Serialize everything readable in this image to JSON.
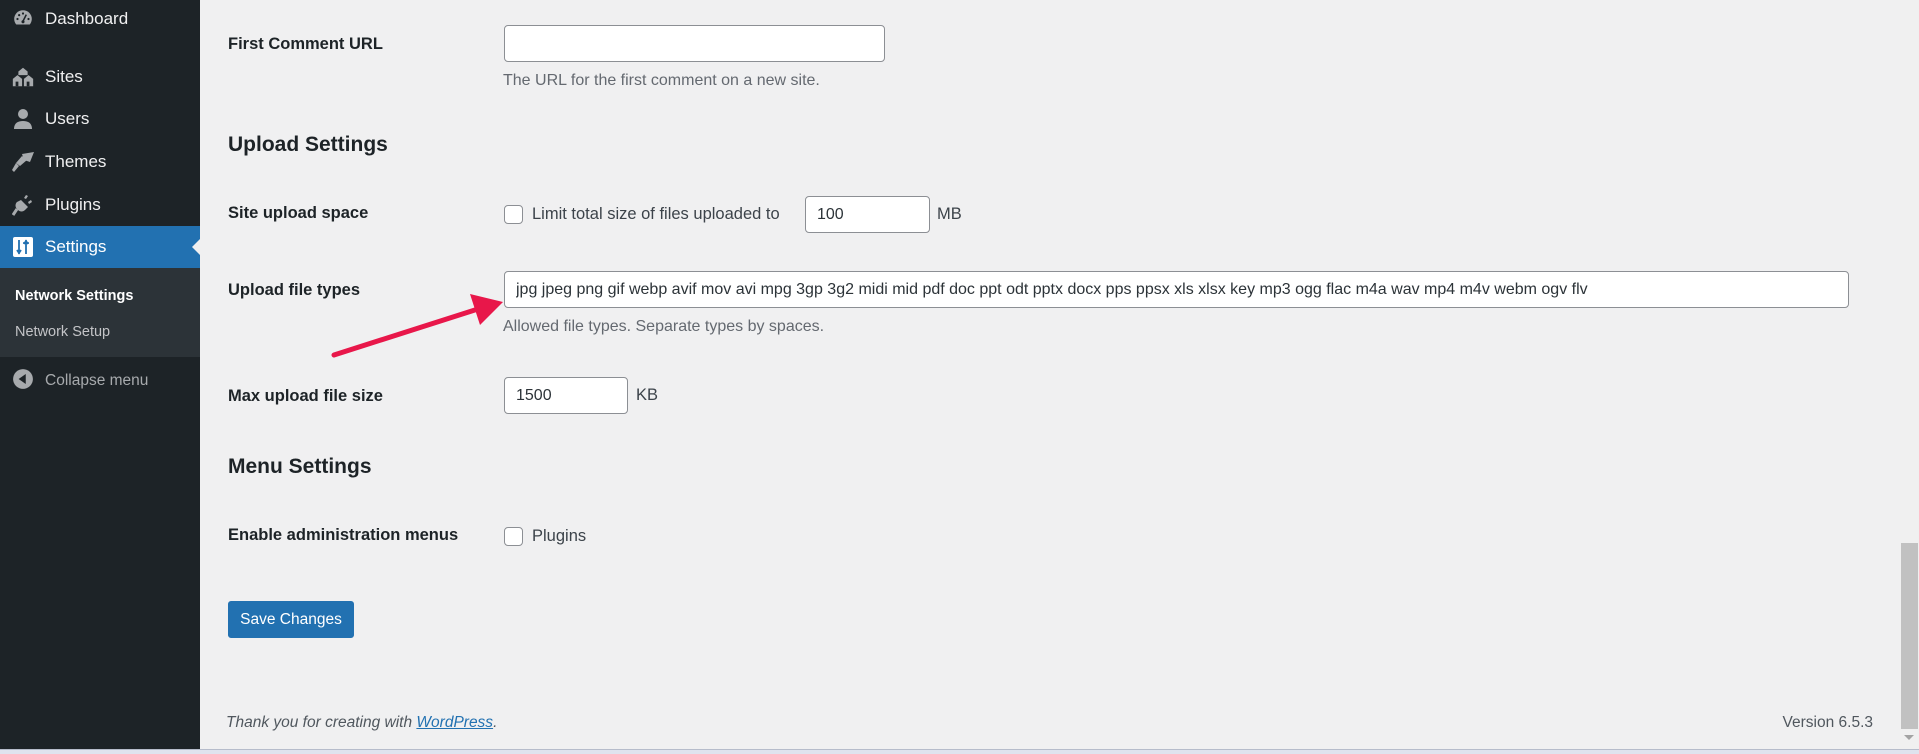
{
  "sidebar": {
    "items": [
      {
        "label": "Dashboard",
        "icon": "dashboard-icon"
      },
      {
        "label": "Sites",
        "icon": "sites-icon"
      },
      {
        "label": "Users",
        "icon": "users-icon"
      },
      {
        "label": "Themes",
        "icon": "themes-icon"
      },
      {
        "label": "Plugins",
        "icon": "plugins-icon"
      },
      {
        "label": "Settings",
        "icon": "settings-icon",
        "active": true
      }
    ],
    "submenu": [
      {
        "label": "Network Settings",
        "current": true
      },
      {
        "label": "Network Setup"
      }
    ],
    "collapse_label": "Collapse menu"
  },
  "main": {
    "first_comment_url": {
      "label": "First Comment URL",
      "value": "",
      "description": "The URL for the first comment on a new site."
    },
    "upload_settings": {
      "title": "Upload Settings",
      "site_upload_space": {
        "label": "Site upload space",
        "checkbox_label": "Limit total size of files uploaded to",
        "checked": false,
        "value": "100",
        "unit": "MB"
      },
      "upload_file_types": {
        "label": "Upload file types",
        "value": "jpg jpeg png gif webp avif mov avi mpg 3gp 3g2 midi mid pdf doc ppt odt pptx docx pps ppsx xls xlsx key mp3 ogg flac m4a wav mp4 m4v webm ogv flv",
        "description": "Allowed file types. Separate types by spaces."
      },
      "max_upload_file_size": {
        "label": "Max upload file size",
        "value": "1500",
        "unit": "KB"
      }
    },
    "menu_settings": {
      "title": "Menu Settings",
      "enable_admin_menus": {
        "label": "Enable administration menus",
        "checkbox_label": "Plugins",
        "checked": false
      }
    },
    "save_label": "Save Changes"
  },
  "footer": {
    "thanks_prefix": "Thank you for creating with ",
    "link_text": "WordPress",
    "thanks_suffix": ".",
    "version": "Version 6.5.3"
  },
  "annotation": {
    "arrow_color": "#e8174a"
  },
  "colors": {
    "sidebar_bg": "#1d2327",
    "accent": "#2271b1",
    "page_bg": "#f0f0f1"
  }
}
